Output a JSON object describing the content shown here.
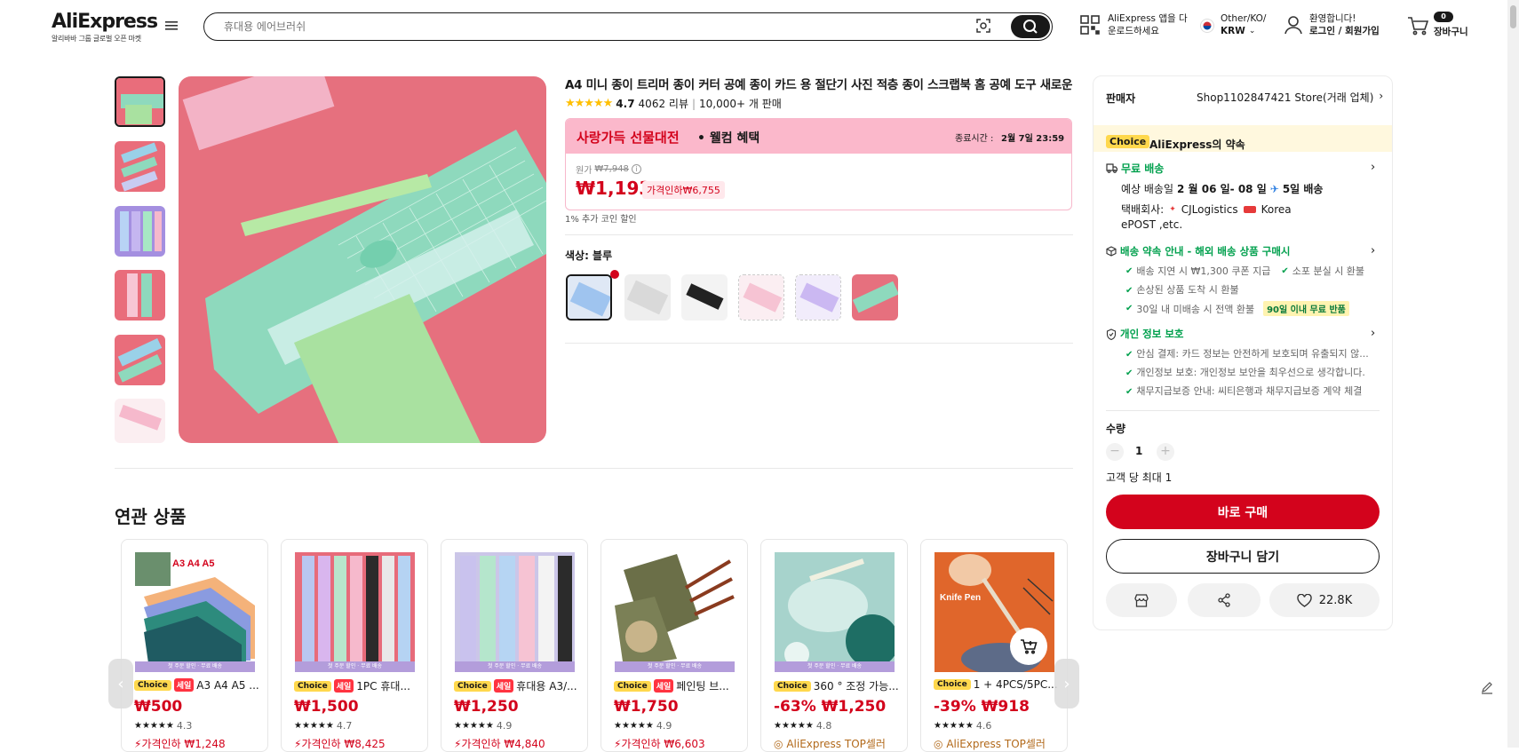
{
  "header": {
    "brand": "AliExpress",
    "tagline": "알리바바 그룹 글로벌 오픈 마켓",
    "search_placeholder": "휴대용 에어브러쉬",
    "app_line1": "AliExpress 앱을 다",
    "app_line2": "운로드하세요",
    "locale_line1": "Other/KO/",
    "locale_line2": "KRW",
    "account_line1": "환영합니다!",
    "account_line2": "로그인 / 회원가입",
    "cart_count": "0",
    "cart_label": "장바구니"
  },
  "product": {
    "title": "A4 미니 종이 트리머 종이 커터 공예 종이 카드 용 절단기 사진 적층 종이 스크랩북 홈 공예 도구 새로운",
    "rating": "4.7",
    "reviews": "4062 리뷰",
    "sold": "10,000+ 개 판매",
    "promo_event": "사랑가득 선물대전",
    "promo_welcome": "• 웰컴 혜택",
    "promo_end_label": "종료시간 :",
    "promo_end_value": "2월 7일 23:59",
    "original_label": "원가",
    "original_price": "₩7,948",
    "price": "₩1,193",
    "discount_tag": "가격인하₩6,755",
    "coin_note": "1% 추가 코인 할인",
    "color_label": "색상: 블루"
  },
  "seller": {
    "label": "판매자",
    "store": "Shop1102847421 Store(거래 업체)",
    "choice_badge": "Choice",
    "promise": "AliExpress의 약속",
    "free_shipping": "무료 배송",
    "eta_prefix": "예상 배송일",
    "eta_dates": "2 월 06 일- 08 일",
    "eta_fast": "5일 배송",
    "carrier_label": "택배회사:",
    "carrier1": "CJLogistics",
    "carrier2": "Korea",
    "carrier3": "ePOST ,etc.",
    "delivery_promise": "배송 약속 안내 - 해외 배송 상품 구매시",
    "dp1": "배송 지연 시 ₩1,300 쿠폰 지급",
    "dp2": "소포 분실 시 환불",
    "dp3": "손상된 상품 도착 시 환불",
    "dp4": "30일 내 미배송 시 전액 환불",
    "dp4_badge": "90일 이내 무료 반품",
    "privacy": "개인 정보 보호",
    "pv1": "안심 결제: 카드 정보는 안전하게 보호되며 유출되지 않...",
    "pv2": "개인정보 보호: 개인정보 보안을 최우선으로 생각합니다.",
    "pv3": "채무지급보증 안내: 씨티은행과 채무지급보증 계약 체결",
    "qty_label": "수량",
    "qty_value": "1",
    "qty_limit": "고객 당 최대 1",
    "buy_now": "바로 구매",
    "add_cart": "장바구니 담기",
    "wish_count": "22.8K"
  },
  "related": {
    "title": "연관 상품",
    "strip_text": "첫 주문 할인 · 무료 배송",
    "items": [
      {
        "name": "A3 A4 A5 ...",
        "sale": true,
        "price": "₩500",
        "rating": "4.3",
        "cut": "가격인하 ₩1,248"
      },
      {
        "name": "1PC 휴대...",
        "sale": true,
        "price": "₩1,500",
        "rating": "4.7",
        "cut": "가격인하 ₩8,425"
      },
      {
        "name": "휴대용 A3/...",
        "sale": true,
        "price": "₩1,250",
        "rating": "4.9",
        "cut": "가격인하 ₩4,840"
      },
      {
        "name": "페인팅 브...",
        "sale": true,
        "price": "₩1,750",
        "rating": "4.9",
        "cut": "가격인하 ₩6,603"
      },
      {
        "name": "360 ° 조정 가능...",
        "sale": false,
        "price": "-63% ₩1,250",
        "rating": "4.8",
        "cut": "AliExpress TOP셀러"
      },
      {
        "name": "1 + 4PCS/5PC...",
        "sale": false,
        "price": "-39% ₩918",
        "rating": "4.6",
        "cut": "AliExpress TOP셀러"
      }
    ]
  },
  "colors": {
    "accent": "#d3031c",
    "green": "#00a04d",
    "promo_pink": "#fbb8cb",
    "choice_yellow": "#ffd84d"
  }
}
